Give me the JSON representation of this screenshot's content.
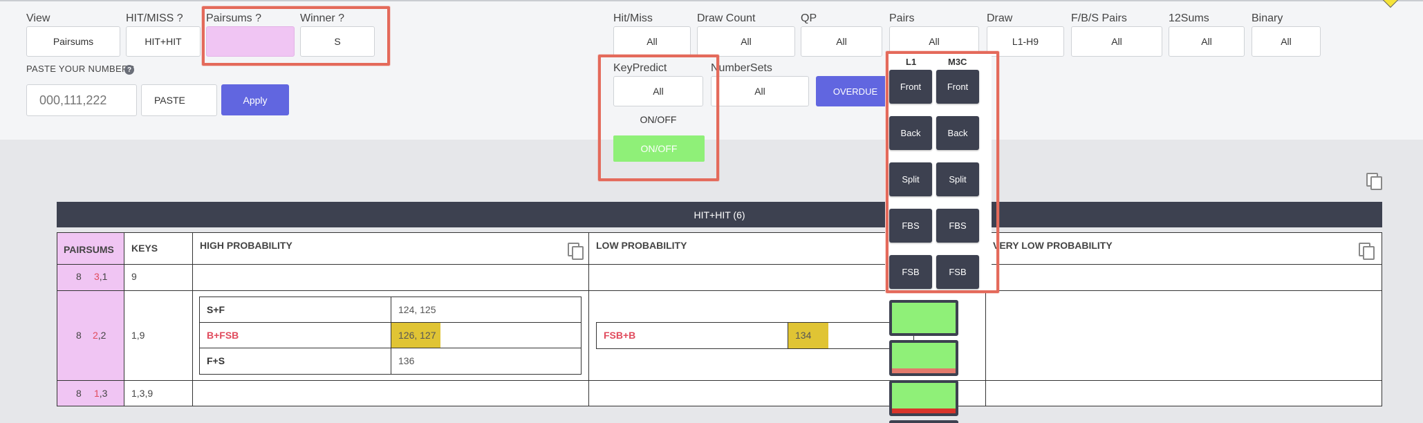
{
  "filters": {
    "view": {
      "label": "View",
      "value": "Pairsums"
    },
    "hitmiss_q": {
      "label": "HIT/MISS ?",
      "value": "HIT+HIT"
    },
    "pairsums_q": {
      "label": "Pairsums ?",
      "value": ""
    },
    "winner_q": {
      "label": "Winner ?",
      "value": "S"
    },
    "paste_label": "PASTE YOUR NUMBERS",
    "numbers_placeholder": "000,111,222",
    "paste_button": "PASTE",
    "apply_button": "Apply"
  },
  "right_filters": [
    {
      "label": "Hit/Miss",
      "value": "All"
    },
    {
      "label": "Draw Count",
      "value": "All"
    },
    {
      "label": "QP",
      "value": "All"
    },
    {
      "label": "Pairs",
      "value": "All"
    },
    {
      "label": "Draw",
      "value": "L1-H9"
    },
    {
      "label": "F/B/S Pairs",
      "value": "All"
    },
    {
      "label": "12Sums",
      "value": "All"
    },
    {
      "label": "Binary",
      "value": "All"
    }
  ],
  "keypredict": {
    "label": "KeyPredict",
    "value": "All",
    "toggle_off": "ON/OFF",
    "toggle_on": "ON/OFF"
  },
  "numbersets": {
    "label": "NumberSets",
    "value": "All"
  },
  "overdue_button": "OVERDUE",
  "pairs_popup": {
    "col_headers": [
      "L1",
      "M3C"
    ],
    "buttons": [
      "Front",
      "Back",
      "Split",
      "FBS",
      "FSB"
    ]
  },
  "table": {
    "title": "HIT+HIT (6)",
    "columns": [
      "PAIRSUMS",
      "KEYS",
      "HIGH PROBABILITY",
      "LOW PROBABILITY",
      "VERY LOW PROBABILITY"
    ],
    "rows": [
      {
        "sum": "8",
        "pair": "3,1",
        "pair_a": "3",
        "pair_b": ",1",
        "keys": "9"
      },
      {
        "sum": "8",
        "pair": "2,2",
        "pair_a": "2",
        "pair_b": ",2",
        "keys": "1,9",
        "high": [
          {
            "name": "S+F",
            "values": "124, 125",
            "red": false,
            "hl": false
          },
          {
            "name": "B+FSB",
            "values": "126, 127",
            "red": true,
            "hl": true
          },
          {
            "name": "F+S",
            "values": "136",
            "red": false,
            "hl": false
          }
        ],
        "low": [
          {
            "name": "FSB+B",
            "values": "134",
            "red": true,
            "hl": true
          }
        ]
      },
      {
        "sum": "8",
        "pair": "1,3",
        "pair_a": "1",
        "pair_b": ",3",
        "keys": "1,3,9"
      }
    ]
  },
  "colors": {
    "accent": "#6166e0",
    "highlight": "#e46a5b",
    "pink": "#f0c5f3",
    "green": "#8ff078",
    "yellow": "#e0c434",
    "dark": "#3d4150"
  }
}
